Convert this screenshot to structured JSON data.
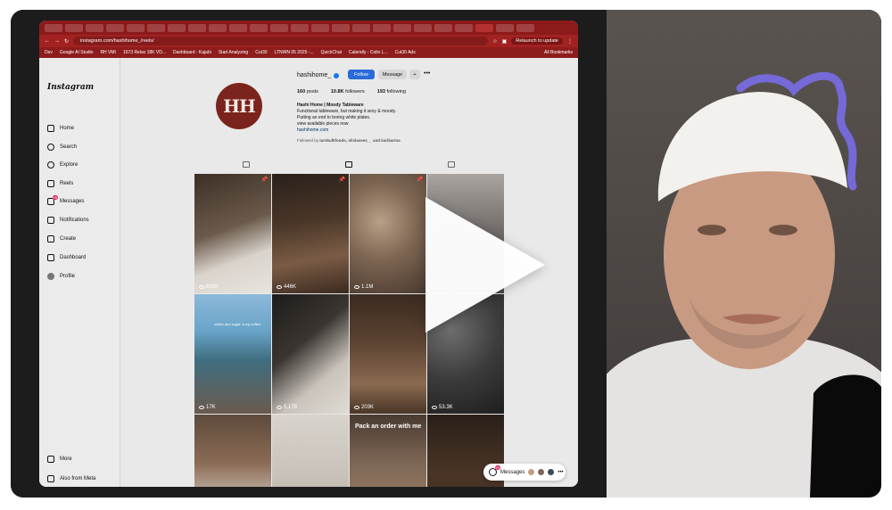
{
  "browser": {
    "tabs": [
      "",
      "",
      "",
      "",
      "",
      "",
      "",
      "",
      "",
      "",
      "",
      "",
      "",
      "",
      "",
      "",
      "",
      "",
      "",
      "",
      "",
      "",
      "",
      ""
    ],
    "url": "instagram.com/hashihome_/reels/",
    "relaunch_label": "Relaunch to update",
    "bookmarks": [
      "Dev",
      "Google AI Studio",
      "RH VMI",
      "1673 Relax 18K VD...",
      "Dashboard - Kajabi",
      "Start Analyzing",
      "Cut30",
      "LTNWN 05 2025 -...",
      "QuickChat",
      "Calendly - Colin L...",
      "Cut30 Ads"
    ],
    "all_bookmarks": "All Bookmarks"
  },
  "instagram": {
    "logo": "Instagram",
    "nav": [
      {
        "label": "Home",
        "icon": "home-icon"
      },
      {
        "label": "Search",
        "icon": "search-icon"
      },
      {
        "label": "Explore",
        "icon": "compass-icon"
      },
      {
        "label": "Reels",
        "icon": "reels-icon"
      },
      {
        "label": "Messages",
        "icon": "messages-icon",
        "badge": "99"
      },
      {
        "label": "Notifications",
        "icon": "heart-icon"
      },
      {
        "label": "Create",
        "icon": "plus-icon"
      },
      {
        "label": "Dashboard",
        "icon": "dashboard-icon"
      },
      {
        "label": "Profile",
        "icon": "avatar"
      }
    ],
    "bottom_nav": [
      {
        "label": "More",
        "icon": "menu-icon"
      },
      {
        "label": "Also from Meta",
        "icon": "meta-icon"
      }
    ],
    "profile": {
      "avatar_text": "HH",
      "username": "hashihome_",
      "follow_label": "Follow",
      "message_label": "Message",
      "add_label": "+",
      "more_label": "•••",
      "posts": "160",
      "posts_label": "posts",
      "followers": "10.8K",
      "followers_label": "followers",
      "following": "193",
      "following_label": "following",
      "bio_name": "Hashi Home | Moody Tableware",
      "bio_lines": [
        "Functional tableware, but making it sexy & moody.",
        "Putting an end to boring white plates.",
        "view available pieces now"
      ],
      "link": "hashihome.com",
      "followed_by_prefix": "Followed by",
      "followed_by": "tarskulkfoods, olivlasees__ and karikarma"
    },
    "grid": [
      {
        "views": "693K",
        "pinned": true,
        "bg": "linear-gradient(160deg,#3d2f26 0%,#6b5a4b 45%,#d9d3cb 70%,#e8e4de 100%)"
      },
      {
        "views": "446K",
        "pinned": true,
        "bg": "linear-gradient(170deg,#2a201b 0%,#4a3628 40%,#7a5c45 70%,#3b2a20 100%)"
      },
      {
        "views": "1.1M",
        "pinned": true,
        "bg": "radial-gradient(circle at 40% 40%,#b89f86 0%,#7d6552 45%,#4a3a2f 100%)"
      },
      {
        "views": "",
        "pinned": false,
        "bg": "linear-gradient(180deg,#a9a4a0 0%,#6f6a67 50%,#4f4a47 100%)"
      },
      {
        "views": "17K",
        "pinned": false,
        "bg": "linear-gradient(180deg,#8cb9d9 0%,#6aa5c9 30%,#3f6e80 55%,#6b5a4e 100%)",
        "caption": "coffee and sugar in my coffee"
      },
      {
        "views": "5,178",
        "pinned": false,
        "bg": "linear-gradient(140deg,#1e1b19 0%,#3a3531 40%,#c9c3bb 70%,#e0dbd4 100%)"
      },
      {
        "views": "203K",
        "pinned": false,
        "bg": "linear-gradient(180deg,#3a2a1f 0%,#5c4332 40%,#8a6a50 75%,#4a3628 100%)"
      },
      {
        "views": "53.3K",
        "pinned": false,
        "bg": "radial-gradient(circle at 30% 30%,#6e6e6e 0%,#3b3b3b 50%,#1e1e1e 100%)"
      },
      {
        "views": "",
        "pinned": false,
        "bg": "linear-gradient(180deg,#5e4a3c 0%,#8a6b54 40%,#d8cfc6 80%,#e6e0d9 100%)"
      },
      {
        "views": "",
        "pinned": false,
        "bg": "linear-gradient(180deg,#d8d3cc 0%,#c9c2b9 50%,#b7afa5 100%)"
      },
      {
        "views": "",
        "pinned": false,
        "bg": "linear-gradient(180deg,#4a3b30 0%,#7d6655 40%,#a88c73 100%)",
        "caption": "Pack an order with me"
      },
      {
        "views": "",
        "pinned": false,
        "bg": "linear-gradient(180deg,#2a1f18 0%,#4a3526 50%,#3a2a1f 100%)"
      }
    ],
    "messages_pill": "Messages",
    "messages_badge": "99"
  }
}
